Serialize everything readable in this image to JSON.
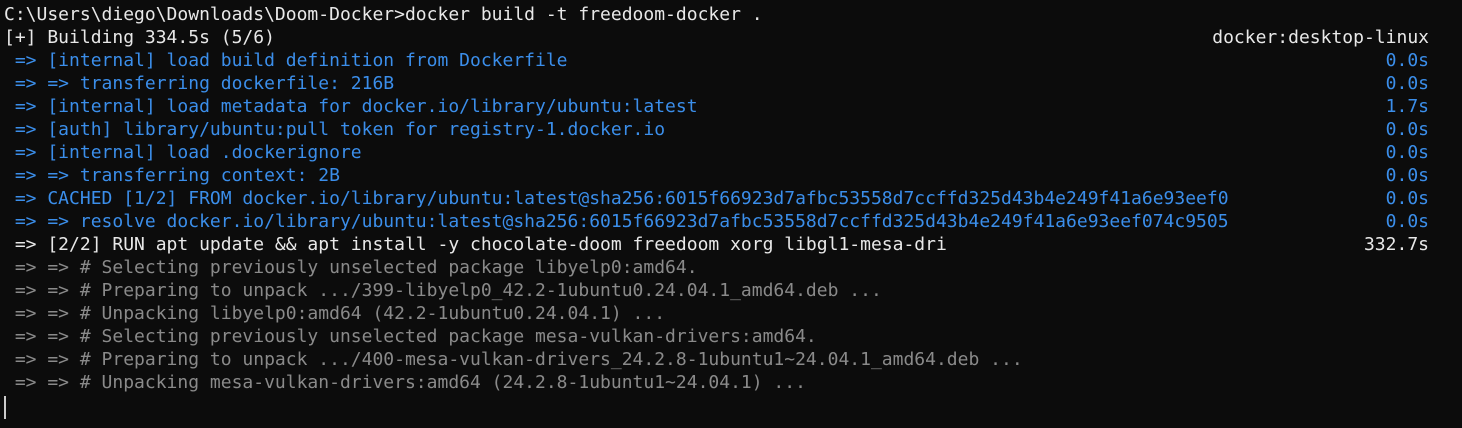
{
  "colors": {
    "background": "#0c0c0c",
    "default_text": "#e8e8e8",
    "step_blue": "#3b8eea",
    "log_gray": "#8a8a8a"
  },
  "terminal": {
    "prompt_line": "C:\\Users\\diego\\Downloads\\Doom-Docker>docker build -t freedoom-docker .",
    "status": {
      "text": "[+] Building 334.5s (5/6)",
      "context": "docker:desktop-linux"
    },
    "steps": [
      {
        "text": " => [internal] load build definition from Dockerfile",
        "time": "0.0s"
      },
      {
        "text": " => => transferring dockerfile: 216B",
        "time": "0.0s"
      },
      {
        "text": " => [internal] load metadata for docker.io/library/ubuntu:latest",
        "time": "1.7s"
      },
      {
        "text": " => [auth] library/ubuntu:pull token for registry-1.docker.io",
        "time": "0.0s"
      },
      {
        "text": " => [internal] load .dockerignore",
        "time": "0.0s"
      },
      {
        "text": " => => transferring context: 2B",
        "time": "0.0s"
      },
      {
        "text": " => CACHED [1/2] FROM docker.io/library/ubuntu:latest@sha256:6015f66923d7afbc53558d7ccffd325d43b4e249f41a6e93eef0",
        "time": "0.0s"
      },
      {
        "text": " => => resolve docker.io/library/ubuntu:latest@sha256:6015f66923d7afbc53558d7ccffd325d43b4e249f41a6e93eef074c9505",
        "time": "0.0s"
      }
    ],
    "running_step": {
      "text": " => [2/2] RUN apt update && apt install -y chocolate-doom freedoom xorg libgl1-mesa-dri",
      "time": "332.7s"
    },
    "log_lines": [
      " => => # Selecting previously unselected package libyelp0:amd64.",
      " => => # Preparing to unpack .../399-libyelp0_42.2-1ubuntu0.24.04.1_amd64.deb ...",
      " => => # Unpacking libyelp0:amd64 (42.2-1ubuntu0.24.04.1) ...",
      " => => # Selecting previously unselected package mesa-vulkan-drivers:amd64.",
      " => => # Preparing to unpack .../400-mesa-vulkan-drivers_24.2.8-1ubuntu1~24.04.1_amd64.deb ...",
      " => => # Unpacking mesa-vulkan-drivers:amd64 (24.2.8-1ubuntu1~24.04.1) ..."
    ]
  }
}
